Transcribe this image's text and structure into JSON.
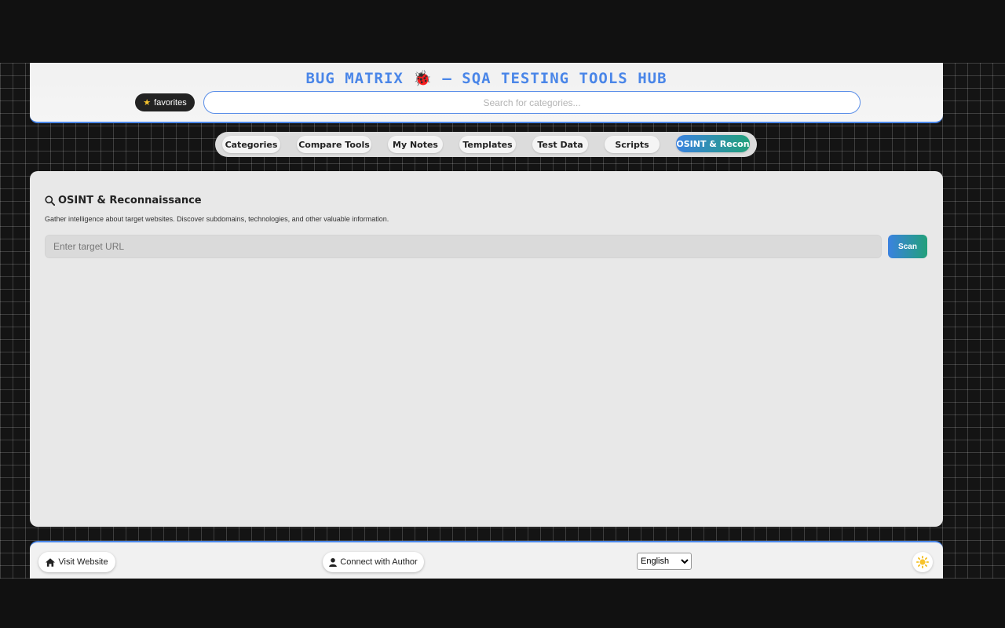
{
  "header": {
    "title": "BUG MATRIX 🐞 – SQA TESTING TOOLS HUB",
    "favorites_label": "favorites",
    "favorites_icon": "star-icon",
    "search_placeholder": "Search for categories..."
  },
  "nav": {
    "items": [
      {
        "label": "Categories"
      },
      {
        "label": "Compare Tools"
      },
      {
        "label": "My Notes"
      },
      {
        "label": "Templates"
      },
      {
        "label": "Test Data"
      },
      {
        "label": "Scripts"
      },
      {
        "label": "OSINT & Recon",
        "active": true
      }
    ]
  },
  "panel": {
    "title_icon": "search-icon",
    "title": "OSINT & Reconnaissance",
    "description": "Gather intelligence about target websites. Discover subdomains, technologies, and other valuable information.",
    "url_placeholder": "Enter target URL",
    "scan_label": "Scan"
  },
  "footer": {
    "visit_label": "Visit Website",
    "visit_icon": "home-icon",
    "connect_label": "Connect with Author",
    "connect_icon": "user-icon",
    "language_selected": "English",
    "theme_icon": "sun-icon"
  },
  "colors": {
    "accent": "#4a86e8",
    "gradient_start": "#3b82e0",
    "gradient_end": "#22a07a"
  }
}
